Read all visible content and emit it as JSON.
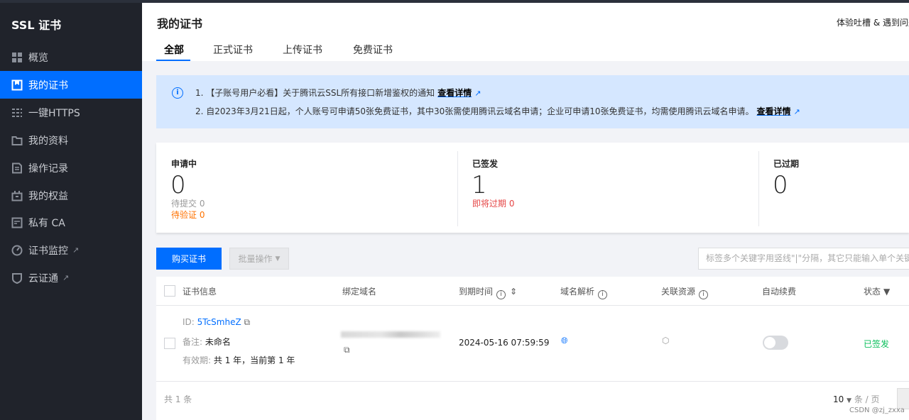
{
  "sidebar": {
    "title": "SSL 证书",
    "items": [
      {
        "label": "概览",
        "icon": "dashboard-icon"
      },
      {
        "label": "我的证书",
        "icon": "certificate-icon",
        "active": true
      },
      {
        "label": "一键HTTPS",
        "icon": "sliders-icon"
      },
      {
        "label": "我的资料",
        "icon": "folder-icon"
      },
      {
        "label": "操作记录",
        "icon": "log-icon"
      },
      {
        "label": "我的权益",
        "icon": "gift-icon"
      },
      {
        "label": "私有 CA",
        "icon": "ca-icon"
      },
      {
        "label": "证书监控",
        "icon": "monitor-icon",
        "external": true
      },
      {
        "label": "云证通",
        "icon": "shield-icon",
        "external": true
      }
    ]
  },
  "header": {
    "title": "我的证书",
    "feedback": "体验吐槽 & 遇到问题",
    "tabs": [
      "全部",
      "正式证书",
      "上传证书",
      "免费证书"
    ]
  },
  "notice": {
    "line1": "1. 【子账号用户必看】关于腾讯云SSL所有接口新增鉴权的通知",
    "line2": "2. 自2023年3月21日起，个人账号可申请50张免费证书，其中30张需使用腾讯云域名申请；企业可申请10张免费证书，均需使用腾讯云域名申请。",
    "link": "查看详情"
  },
  "stats": [
    {
      "label": "申请中",
      "value": "0",
      "subs": [
        {
          "text": "待提交 0",
          "color": "#999999"
        },
        {
          "text": "待验证 0",
          "color": "#ff7200"
        }
      ]
    },
    {
      "label": "已签发",
      "value": "1",
      "subs": [
        {
          "text": "即将过期 0",
          "color": "#e54545"
        }
      ]
    },
    {
      "label": "已过期",
      "value": "0",
      "subs": []
    }
  ],
  "toolbar": {
    "buy": "购买证书",
    "batch": "批量操作",
    "search_placeholder": "标签多个关键字用竖线\"|\"分隔，其它只能输入单个关键字"
  },
  "table": {
    "headers": [
      "证书信息",
      "绑定域名",
      "到期时间",
      "域名解析",
      "关联资源",
      "自动续费",
      "状态"
    ],
    "rows": [
      {
        "id_label": "ID:",
        "id": "5TcSmheZ",
        "note_label": "备注:",
        "note": "未命名",
        "validity_label": "有效期:",
        "validity": "共 1 年，当前第 1 年",
        "expires": "2024-05-16 07:59:59",
        "auto_renew": false,
        "status": "已签发"
      }
    ],
    "total": "共 1 条",
    "page_size": "10",
    "per_page": "条 / 页"
  },
  "watermark": "CSDN @zj_zxxa",
  "colors": {
    "accent": "#006eff",
    "success": "#0abf5b",
    "sidebar": "#20232b"
  }
}
